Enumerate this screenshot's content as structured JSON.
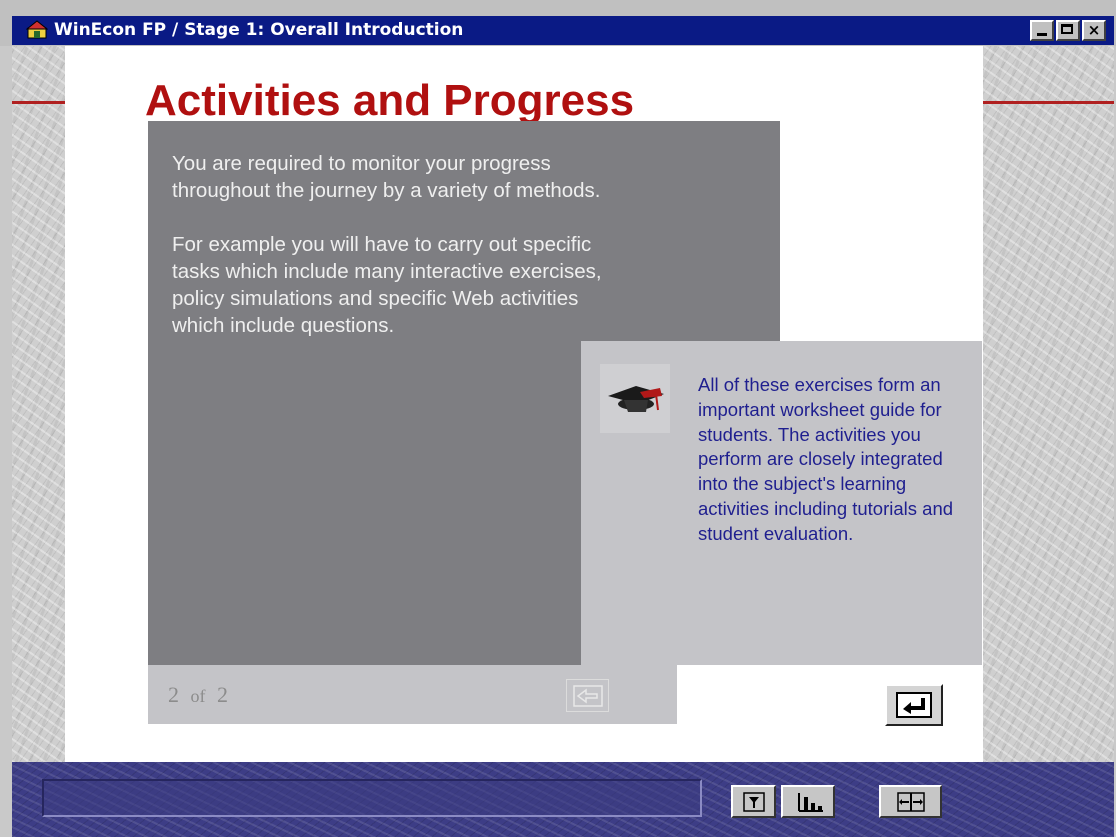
{
  "window": {
    "title": "WinEcon FP / Stage 1: Overall Introduction",
    "close_glyph": "×"
  },
  "colors": {
    "title_bar": "#0a1a85",
    "heading": "#b01010",
    "dark_panel": "#7e7e82",
    "side_text": "#1f1f8f",
    "toolbar": "#3d3d86"
  },
  "page": {
    "heading": "Activities and Progress",
    "main_paragraphs": [
      "You are required to monitor your progress throughout the journey by a variety of methods.",
      "For example you will have to carry out specific tasks which include many interactive exercises, policy simulations and specific Web activities which include questions."
    ],
    "side_text": "All of these exercises form an important worksheet guide for students. The activities you perform are closely integrated into the subject's learning activities including tutorials and student evaluation.",
    "pager": {
      "current": "2",
      "of": "of",
      "total": "2"
    }
  },
  "icons": {
    "app": "winecon-app-icon",
    "side": "graduation-cap-icon",
    "back": "back-arrow-icon",
    "next": "return-arrow-icon",
    "toolbar": [
      "help-icon",
      "chart-icon",
      "exit-icon"
    ]
  }
}
